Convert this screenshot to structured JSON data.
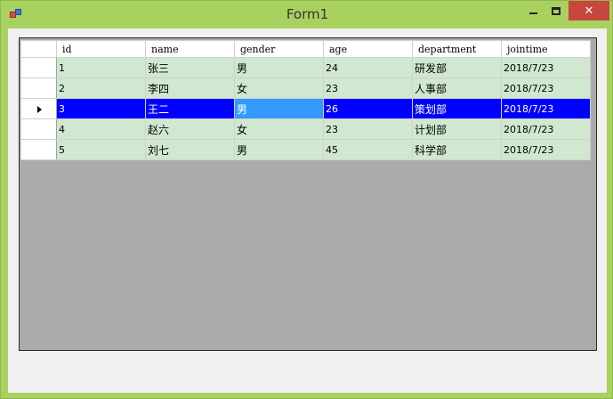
{
  "window": {
    "title": "Form1"
  },
  "grid": {
    "columns": [
      "id",
      "name",
      "gender",
      "age",
      "department",
      "jointime"
    ],
    "rows": [
      [
        "1",
        "张三",
        "男",
        "24",
        "研发部",
        "2018/7/23"
      ],
      [
        "2",
        "李四",
        "女",
        "23",
        "人事部",
        "2018/7/23"
      ],
      [
        "3",
        "王二",
        "男",
        "26",
        "策划部",
        "2018/7/23"
      ],
      [
        "4",
        "赵六",
        "女",
        "23",
        "计划部",
        "2018/7/23"
      ],
      [
        "5",
        "刘七",
        "男",
        "45",
        "科学部",
        "2018/7/23"
      ]
    ],
    "selected_row": 2,
    "current_cell_column": 2
  },
  "colors": {
    "selection": "#0000ff",
    "current_cell": "#3399ff",
    "cell_background": "#cfe8cf",
    "empty_area": "#ababab",
    "close_button": "#c7463e"
  }
}
